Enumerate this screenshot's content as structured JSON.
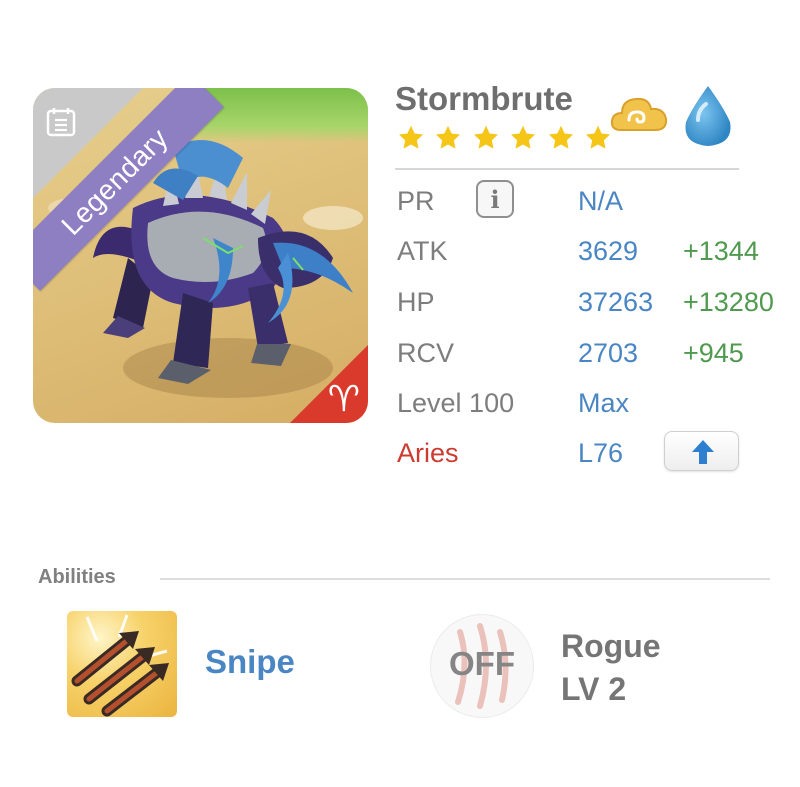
{
  "creature": {
    "name": "Stormbrute",
    "rarity": "Legendary",
    "stars": 6,
    "star_color": "#f5c518",
    "zodiac_sign_icon": "aries-icon",
    "element_icons": [
      "cloud-icon",
      "water-drop-icon"
    ]
  },
  "stats": {
    "pr": {
      "label": "PR",
      "value": "N/A"
    },
    "atk": {
      "label": "ATK",
      "value": "3629",
      "bonus": "+1344"
    },
    "hp": {
      "label": "HP",
      "value": "37263",
      "bonus": "+13280"
    },
    "rcv": {
      "label": "RCV",
      "value": "2703",
      "bonus": "+945"
    },
    "level": {
      "label": "Level 100",
      "value": "Max"
    },
    "sign": {
      "label": "Aries",
      "value": "L76"
    }
  },
  "abilities": {
    "heading": "Abilities",
    "items": [
      {
        "name": "Snipe",
        "icon": "snipe-arrows-icon"
      },
      {
        "state": "OFF",
        "name": "Rogue",
        "level": "LV 2",
        "icon": "claw-scratch-icon"
      }
    ]
  },
  "colors": {
    "value_blue": "#4a86c4",
    "bonus_green": "#4f9a4f",
    "sign_red": "#cd3b30",
    "ribbon_purple": "#8e7fc3"
  }
}
